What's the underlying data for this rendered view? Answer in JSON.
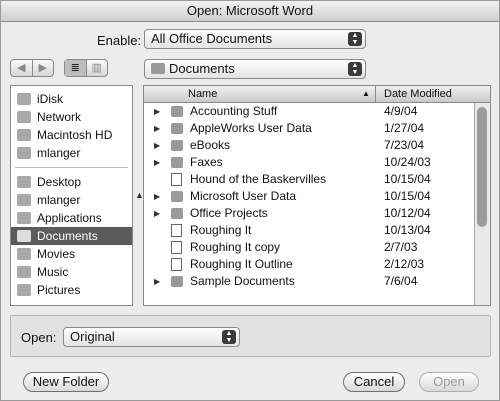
{
  "window": {
    "title": "Open: Microsoft Word"
  },
  "enable": {
    "label": "Enable:",
    "value": "All Office Documents"
  },
  "nav": {
    "back_glyph": "◀",
    "forward_glyph": "▶",
    "list_view_glyph": "≣",
    "column_view_glyph": "▥"
  },
  "location": {
    "value": "Documents"
  },
  "sidebar": {
    "group1": [
      {
        "label": "iDisk",
        "icon": "idisk-icon"
      },
      {
        "label": "Network",
        "icon": "network-icon"
      },
      {
        "label": "Macintosh HD",
        "icon": "harddisk-icon"
      },
      {
        "label": "mlanger",
        "icon": "user-icon"
      }
    ],
    "group2": [
      {
        "label": "Desktop",
        "icon": "desktop-icon"
      },
      {
        "label": "mlanger",
        "icon": "home-icon"
      },
      {
        "label": "Applications",
        "icon": "applications-icon"
      },
      {
        "label": "Documents",
        "icon": "documents-icon",
        "selected": true
      },
      {
        "label": "Movies",
        "icon": "movies-icon"
      },
      {
        "label": "Music",
        "icon": "music-icon"
      },
      {
        "label": "Pictures",
        "icon": "pictures-icon"
      }
    ]
  },
  "file_list": {
    "columns": {
      "name": "Name",
      "date": "Date Modified"
    },
    "rows": [
      {
        "name": "Accounting Stuff",
        "date": "4/9/04",
        "folder": true
      },
      {
        "name": "AppleWorks User Data",
        "date": "1/27/04",
        "folder": true
      },
      {
        "name": "eBooks",
        "date": "7/23/04",
        "folder": true
      },
      {
        "name": "Faxes",
        "date": "10/24/03",
        "folder": true
      },
      {
        "name": "Hound of the Baskervilles",
        "date": "10/15/04",
        "folder": false
      },
      {
        "name": "Microsoft User Data",
        "date": "10/15/04",
        "folder": true
      },
      {
        "name": "Office Projects",
        "date": "10/12/04",
        "folder": true
      },
      {
        "name": "Roughing It",
        "date": "10/13/04",
        "folder": false
      },
      {
        "name": "Roughing It copy",
        "date": "2/7/03",
        "folder": false
      },
      {
        "name": "Roughing It Outline",
        "date": "2/12/03",
        "folder": false
      },
      {
        "name": "Sample Documents",
        "date": "7/6/04",
        "folder": true
      }
    ]
  },
  "open_panel": {
    "label": "Open:",
    "value": "Original"
  },
  "buttons": {
    "new_folder": "New Folder",
    "cancel": "Cancel",
    "open": "Open"
  }
}
